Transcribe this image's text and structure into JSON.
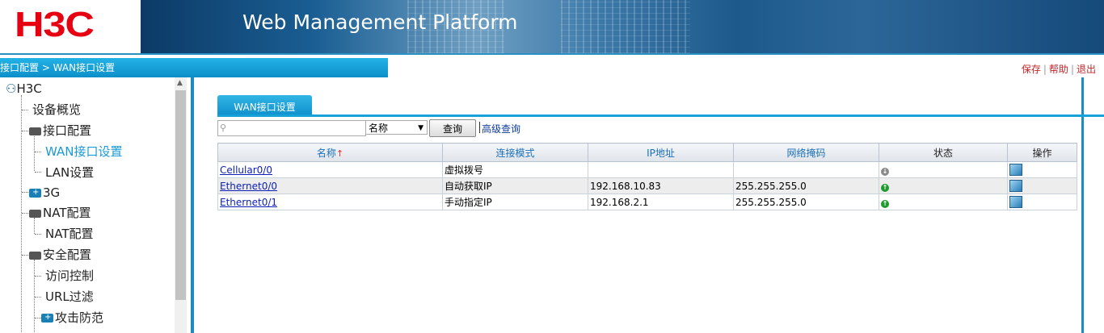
{
  "header": {
    "logo": "H3C",
    "title": "Web Management Platform"
  },
  "breadcrumb": "接口配置 > WAN接口设置",
  "top_links": {
    "save": "保存",
    "help": "帮助",
    "logout": "退出"
  },
  "tree": {
    "root": "H3C",
    "items": [
      {
        "label": "设备概览"
      },
      {
        "label": "接口配置"
      },
      {
        "label": "WAN接口设置"
      },
      {
        "label": "LAN设置"
      },
      {
        "label": "3G"
      },
      {
        "label": "NAT配置"
      },
      {
        "label": "NAT配置"
      },
      {
        "label": "安全配置"
      },
      {
        "label": "访问控制"
      },
      {
        "label": "URL过滤"
      },
      {
        "label": "攻击防范"
      }
    ]
  },
  "tab": "WAN接口设置",
  "search": {
    "placeholder": "",
    "field": "名称",
    "button": "查询",
    "advanced": "高级查询"
  },
  "table": {
    "headers": [
      "名称",
      "连接模式",
      "IP地址",
      "网络掩码",
      "状态",
      "操作"
    ],
    "rows": [
      {
        "name": "Cellular0/0",
        "mode": "虚拟拨号",
        "ip": "",
        "mask": "",
        "status": "down"
      },
      {
        "name": "Ethernet0/0",
        "mode": "自动获取IP",
        "ip": "192.168.10.83",
        "mask": "255.255.255.0",
        "status": "up"
      },
      {
        "name": "Ethernet0/1",
        "mode": "手动指定IP",
        "ip": "192.168.2.1",
        "mask": "255.255.255.0",
        "status": "up"
      }
    ]
  },
  "colors": {
    "accent": "#1a9ad6",
    "brand": "#e60012",
    "link": "#0d1fb4"
  }
}
